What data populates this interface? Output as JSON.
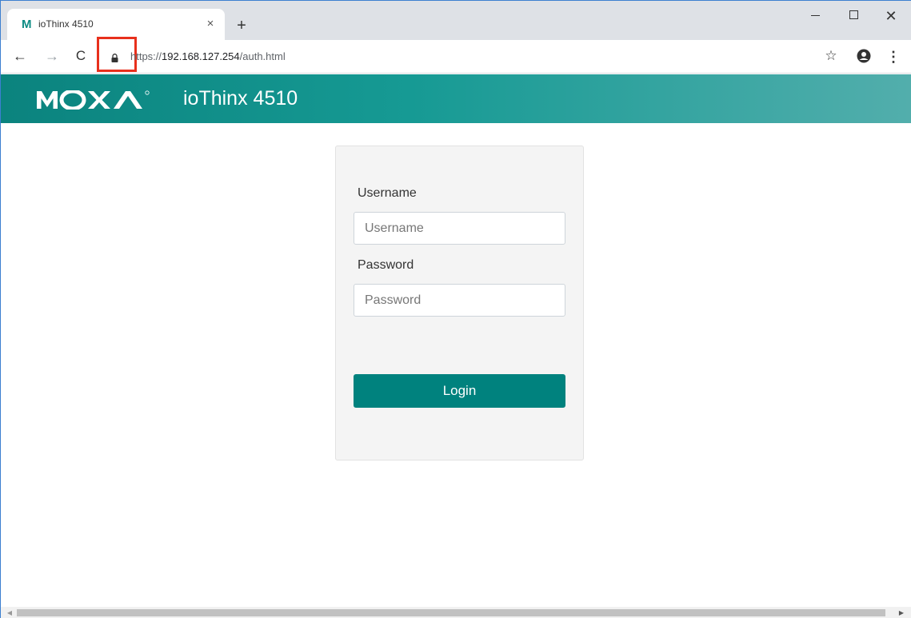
{
  "browser": {
    "tab": {
      "favicon": "M",
      "title": "ioThinx 4510",
      "close_glyph": "×"
    },
    "new_tab_glyph": "+",
    "window_controls": {
      "close_glyph": "✕"
    },
    "nav": {
      "back_glyph": "←",
      "forward_glyph": "→",
      "reload_glyph": "C"
    },
    "url": {
      "scheme": "https://",
      "host": "192.168.127.254",
      "path": "/auth.html"
    },
    "star_glyph": "☆",
    "menu_glyph": "⋮",
    "icons": [
      "lock-icon",
      "star-icon",
      "profile-icon",
      "menu-icon"
    ]
  },
  "header": {
    "brand": "MOXA",
    "product": "ioThinx 4510",
    "gradient_start": "#0b837e",
    "gradient_end": "#52aeac"
  },
  "login": {
    "username_label": "Username",
    "username_placeholder": "Username",
    "password_label": "Password",
    "password_placeholder": "Password",
    "submit_label": "Login",
    "button_color": "#00827e"
  },
  "annotation": {
    "highlight_color": "#e8301c"
  }
}
